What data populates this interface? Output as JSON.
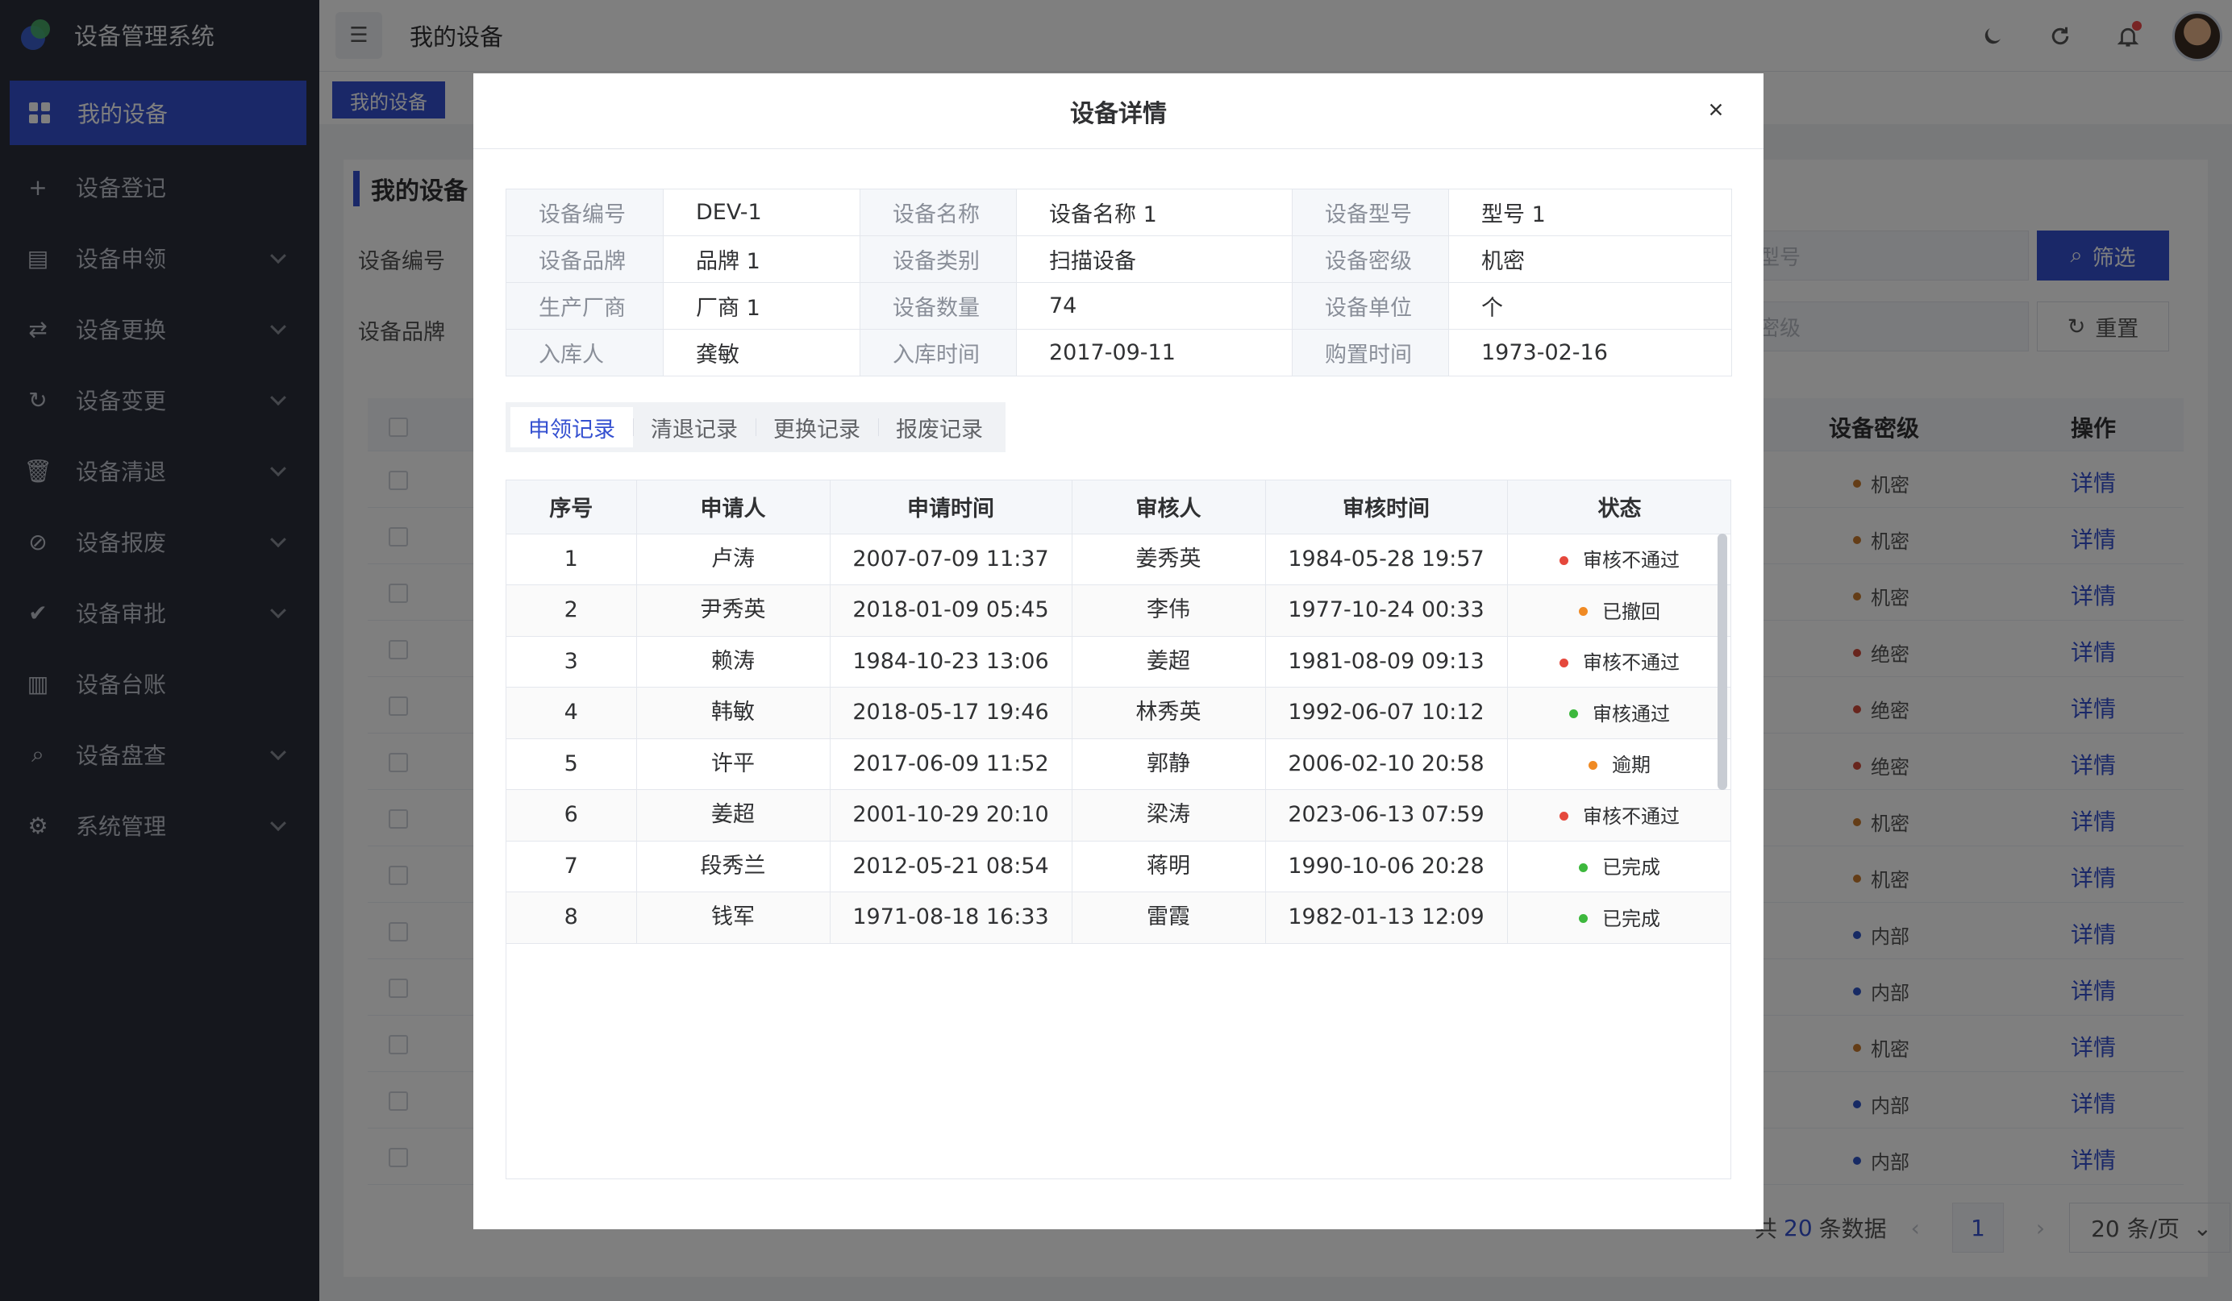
{
  "app": {
    "title": "设备管理系统"
  },
  "sidebar": {
    "items": [
      {
        "label": "我的设备",
        "icon": "grid-icon",
        "active": true
      },
      {
        "label": "设备登记",
        "icon": "plus-icon"
      },
      {
        "label": "设备申领",
        "icon": "clipboard-icon",
        "expandable": true
      },
      {
        "label": "设备更换",
        "icon": "swap-icon",
        "expandable": true
      },
      {
        "label": "设备变更",
        "icon": "refresh-icon",
        "expandable": true
      },
      {
        "label": "设备清退",
        "icon": "trash-icon",
        "expandable": true
      },
      {
        "label": "设备报废",
        "icon": "ban-icon",
        "expandable": true
      },
      {
        "label": "设备审批",
        "icon": "check-circle-icon",
        "expandable": true
      },
      {
        "label": "设备台账",
        "icon": "ledger-icon"
      },
      {
        "label": "设备盘查",
        "icon": "search-icon",
        "expandable": true
      },
      {
        "label": "系统管理",
        "icon": "gears-icon",
        "expandable": true
      }
    ]
  },
  "header": {
    "page_title": "我的设备"
  },
  "tagbar": {
    "active_tag": "我的设备"
  },
  "background": {
    "card_title": "我的设备",
    "filter_labels": [
      "设备编号",
      "设备品牌"
    ],
    "placeholders": [
      "型号",
      "密级"
    ],
    "filter_button": "筛选",
    "reset_button": "重置",
    "columns": {
      "level": "设备密级",
      "action": "操作"
    },
    "rows": [
      {
        "level": "机密",
        "color": "#c97b2e",
        "action": "详情"
      },
      {
        "level": "机密",
        "color": "#c97b2e",
        "action": "详情"
      },
      {
        "level": "机密",
        "color": "#c97b2e",
        "action": "详情"
      },
      {
        "level": "绝密",
        "color": "#d14a3a",
        "action": "详情"
      },
      {
        "level": "绝密",
        "color": "#d14a3a",
        "action": "详情"
      },
      {
        "level": "绝密",
        "color": "#d14a3a",
        "action": "详情"
      },
      {
        "level": "机密",
        "color": "#c97b2e",
        "action": "详情"
      },
      {
        "level": "机密",
        "color": "#c97b2e",
        "action": "详情"
      },
      {
        "level": "内部",
        "color": "#2f55c9",
        "action": "详情"
      },
      {
        "level": "内部",
        "color": "#2f55c9",
        "action": "详情"
      },
      {
        "level": "机密",
        "color": "#c97b2e",
        "action": "详情"
      },
      {
        "level": "内部",
        "color": "#2f55c9",
        "action": "详情"
      },
      {
        "level": "内部",
        "color": "#2f55c9",
        "action": "详情"
      }
    ],
    "pager": {
      "prefix": "共",
      "total": "20",
      "suffix": "条数据",
      "current": "1",
      "page_size": "20 条/页"
    }
  },
  "modal": {
    "title": "设备详情",
    "details": [
      [
        {
          "label": "设备编号",
          "value": "DEV-1"
        },
        {
          "label": "设备名称",
          "value": "设备名称 1"
        },
        {
          "label": "设备型号",
          "value": "型号 1"
        }
      ],
      [
        {
          "label": "设备品牌",
          "value": "品牌 1"
        },
        {
          "label": "设备类别",
          "value": "扫描设备"
        },
        {
          "label": "设备密级",
          "value": "机密"
        }
      ],
      [
        {
          "label": "生产厂商",
          "value": "厂商 1"
        },
        {
          "label": "设备数量",
          "value": "74"
        },
        {
          "label": "设备单位",
          "value": "个"
        }
      ],
      [
        {
          "label": "入库人",
          "value": "龚敏"
        },
        {
          "label": "入库时间",
          "value": "2017-09-11"
        },
        {
          "label": "购置时间",
          "value": "1973-02-16"
        }
      ]
    ],
    "tabs": [
      "申领记录",
      "清退记录",
      "更换记录",
      "报废记录"
    ],
    "active_tab": 0,
    "records": {
      "columns": [
        "序号",
        "申请人",
        "申请时间",
        "审核人",
        "审核时间",
        "状态"
      ],
      "rows": [
        {
          "no": "1",
          "applicant": "卢涛",
          "apply_time": "2007-07-09 11:37",
          "reviewer": "姜秀英",
          "review_time": "1984-05-28 19:57",
          "status": "审核不通过",
          "status_color": "#e5483c"
        },
        {
          "no": "2",
          "applicant": "尹秀英",
          "apply_time": "2018-01-09 05:45",
          "reviewer": "李伟",
          "review_time": "1977-10-24 00:33",
          "status": "已撤回",
          "status_color": "#f08a24"
        },
        {
          "no": "3",
          "applicant": "赖涛",
          "apply_time": "1984-10-23 13:06",
          "reviewer": "姜超",
          "review_time": "1981-08-09 09:13",
          "status": "审核不通过",
          "status_color": "#e5483c"
        },
        {
          "no": "4",
          "applicant": "韩敏",
          "apply_time": "2018-05-17 19:46",
          "reviewer": "林秀英",
          "review_time": "1992-06-07 10:12",
          "status": "审核通过",
          "status_color": "#3db83d"
        },
        {
          "no": "5",
          "applicant": "许平",
          "apply_time": "2017-06-09 11:52",
          "reviewer": "郭静",
          "review_time": "2006-02-10 20:58",
          "status": "逾期",
          "status_color": "#f08a24"
        },
        {
          "no": "6",
          "applicant": "姜超",
          "apply_time": "2001-10-29 20:10",
          "reviewer": "梁涛",
          "review_time": "2023-06-13 07:59",
          "status": "审核不通过",
          "status_color": "#e5483c"
        },
        {
          "no": "7",
          "applicant": "段秀兰",
          "apply_time": "2012-05-21 08:54",
          "reviewer": "蒋明",
          "review_time": "1990-10-06 20:28",
          "status": "已完成",
          "status_color": "#3db83d"
        },
        {
          "no": "8",
          "applicant": "钱军",
          "apply_time": "1971-08-18 16:33",
          "reviewer": "雷霞",
          "review_time": "1982-01-13 12:09",
          "status": "已完成",
          "status_color": "#3db83d"
        }
      ]
    }
  }
}
